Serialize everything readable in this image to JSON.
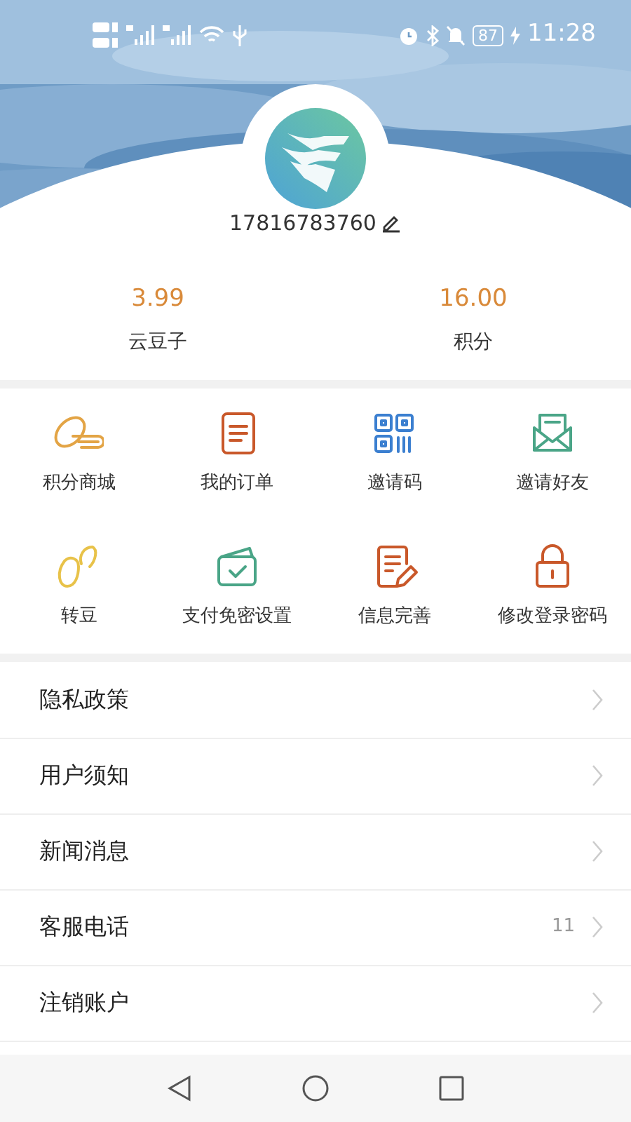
{
  "status_bar": {
    "battery": "87",
    "time": "11:28"
  },
  "profile": {
    "phone": "17816783760"
  },
  "stats": [
    {
      "value": "3.99",
      "label": "云豆子"
    },
    {
      "value": "16.00",
      "label": "积分"
    }
  ],
  "features": [
    {
      "label": "积分商城"
    },
    {
      "label": "我的订单"
    },
    {
      "label": "邀请码"
    },
    {
      "label": "邀请好友"
    },
    {
      "label": "转豆"
    },
    {
      "label": "支付免密设置"
    },
    {
      "label": "信息完善"
    },
    {
      "label": "修改登录密码"
    }
  ],
  "menu": [
    {
      "label": "隐私政策"
    },
    {
      "label": "用户须知"
    },
    {
      "label": "新闻消息"
    },
    {
      "label": "客服电话",
      "detail": "11"
    },
    {
      "label": "注销账户"
    }
  ]
}
